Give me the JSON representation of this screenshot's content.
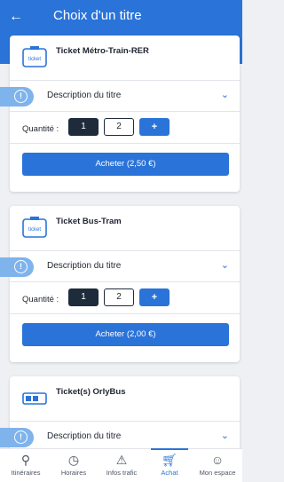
{
  "header": {
    "title": "Choix d'un titre",
    "back_icon": "arrow-left-icon"
  },
  "tickets": [
    {
      "name": "Ticket Métro-Train-RER",
      "description_label": "Description du titre",
      "quantity_label": "Quantité :",
      "minus": "1",
      "quantity": "2",
      "plus": "+",
      "buy_label": "Acheter (2,50 €)"
    },
    {
      "name": "Ticket Bus-Tram",
      "description_label": "Description du titre",
      "quantity_label": "Quantité :",
      "minus": "1",
      "quantity": "2",
      "plus": "+",
      "buy_label": "Acheter (2,00 €)"
    },
    {
      "name": "Ticket(s) OrlyBus",
      "description_label": "Description du titre"
    }
  ],
  "nav": [
    {
      "label": "Itinéraires",
      "icon": "map-pin-icon"
    },
    {
      "label": "Horaires",
      "icon": "clock-icon"
    },
    {
      "label": "Infos trafic",
      "icon": "warning-icon"
    },
    {
      "label": "Achat",
      "icon": "cart-icon",
      "active": true
    },
    {
      "label": "Mon espace",
      "icon": "user-icon"
    }
  ],
  "colors": {
    "accent": "#2a73d8",
    "dark": "#1e2b3a",
    "info": "#7fb3ec"
  }
}
